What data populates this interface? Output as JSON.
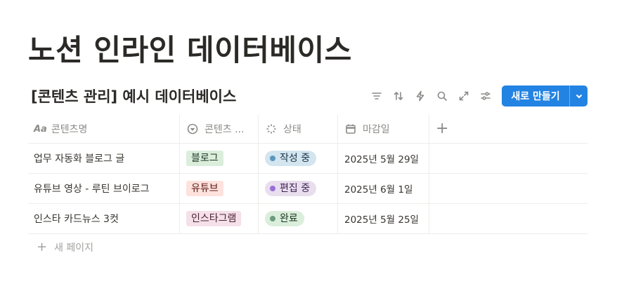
{
  "page": {
    "title": "노션 인라인 데이터베이스"
  },
  "database": {
    "title": "[콘텐츠 관리] 예시 데이터베이스",
    "toolbar": {
      "icons": [
        "filter-icon",
        "sort-icon",
        "automation-icon",
        "search-icon",
        "expand-icon",
        "settings-icon"
      ],
      "new_button_label": "새로 만들기"
    },
    "columns": [
      {
        "label": "콘텐츠명",
        "icon": "text-icon"
      },
      {
        "label": "콘텐츠 ...",
        "icon": "select-icon"
      },
      {
        "label": "상태",
        "icon": "status-icon"
      },
      {
        "label": "마감일",
        "icon": "calendar-icon"
      }
    ],
    "rows": [
      {
        "name": "업무 자동화 블로그 글",
        "type": {
          "label": "블로그",
          "bg": "#dbeddb",
          "color": "#1c3829"
        },
        "status": {
          "label": "작성 중",
          "bg": "#d3e5ef",
          "dot": "#5b97bd",
          "color": "#183347"
        },
        "due": "2025년 5월 29일"
      },
      {
        "name": "유튜브 영상 - 루틴 브이로그",
        "type": {
          "label": "유튜브",
          "bg": "#ffe2dd",
          "color": "#5d1715"
        },
        "status": {
          "label": "편집 중",
          "bg": "#e8deee",
          "dot": "#9a6dd7",
          "color": "#412454"
        },
        "due": "2025년 6월 1일"
      },
      {
        "name": "인스타 카드뉴스 3컷",
        "type": {
          "label": "인스타그램",
          "bg": "#f5e0e9",
          "color": "#4c2337"
        },
        "status": {
          "label": "완료",
          "bg": "#dbeddb",
          "dot": "#6c9b7d",
          "color": "#1c3829"
        },
        "due": "2025년 5월 25일"
      }
    ],
    "new_page_label": "새 페이지"
  }
}
